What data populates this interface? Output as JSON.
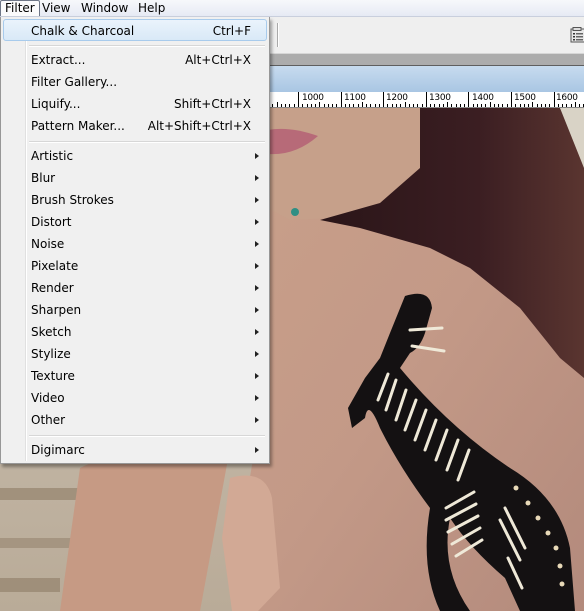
{
  "menubar": {
    "items": [
      {
        "label": "Filter",
        "active": true
      },
      {
        "label": "View"
      },
      {
        "label": "Window"
      },
      {
        "label": "Help"
      }
    ]
  },
  "toolbar": {
    "palette_icon": "palette-well-icon"
  },
  "ruler": {
    "labels": [
      "1000",
      "1100",
      "1200",
      "1300",
      "1400",
      "1500",
      "1600"
    ]
  },
  "filter_menu": {
    "last_filter": {
      "label": "Chalk & Charcoal",
      "shortcut": "Ctrl+F"
    },
    "group1": [
      {
        "label": "Extract...",
        "shortcut": "Alt+Ctrl+X"
      },
      {
        "label": "Filter Gallery...",
        "shortcut": ""
      },
      {
        "label": "Liquify...",
        "shortcut": "Shift+Ctrl+X"
      },
      {
        "label": "Pattern Maker...",
        "shortcut": "Alt+Shift+Ctrl+X"
      }
    ],
    "submenus": [
      {
        "label": "Artistic"
      },
      {
        "label": "Blur"
      },
      {
        "label": "Brush Strokes"
      },
      {
        "label": "Distort"
      },
      {
        "label": "Noise"
      },
      {
        "label": "Pixelate"
      },
      {
        "label": "Render"
      },
      {
        "label": "Sharpen"
      },
      {
        "label": "Sketch"
      },
      {
        "label": "Stylize"
      },
      {
        "label": "Texture"
      },
      {
        "label": "Video"
      },
      {
        "label": "Other"
      }
    ],
    "plugins": [
      {
        "label": "Digimarc"
      }
    ]
  },
  "colors": {
    "highlight_border": "#a8cbec",
    "window_title": "#a9c6e3"
  }
}
